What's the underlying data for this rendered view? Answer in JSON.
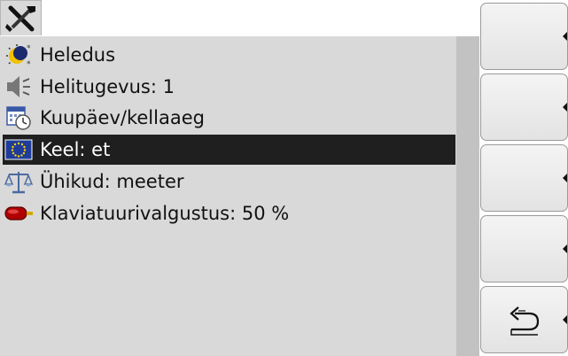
{
  "tab": {
    "icon": "tools-icon"
  },
  "menu": {
    "items": [
      {
        "label": "Heledus",
        "icon": "brightness-icon",
        "selected": false
      },
      {
        "label": "Helitugevus: 1",
        "icon": "speaker-icon",
        "selected": false
      },
      {
        "label": "Kuupäev/kellaaeg",
        "icon": "calendar-clock-icon",
        "selected": false
      },
      {
        "label": "Keel: et",
        "icon": "eu-flag-icon",
        "selected": true
      },
      {
        "label": "Ühikud: meeter",
        "icon": "scale-icon",
        "selected": false
      },
      {
        "label": "Klaviatuurivalgustus:  50 %",
        "icon": "keyboard-light-icon",
        "selected": false
      }
    ]
  },
  "softkeys": [
    {
      "icon": ""
    },
    {
      "icon": ""
    },
    {
      "icon": ""
    },
    {
      "icon": ""
    },
    {
      "icon": "return-icon"
    }
  ],
  "colors": {
    "panel": "#d9d9d9",
    "selected_row": "#1f1f1f",
    "scrollbar": "#c2c2c2"
  }
}
